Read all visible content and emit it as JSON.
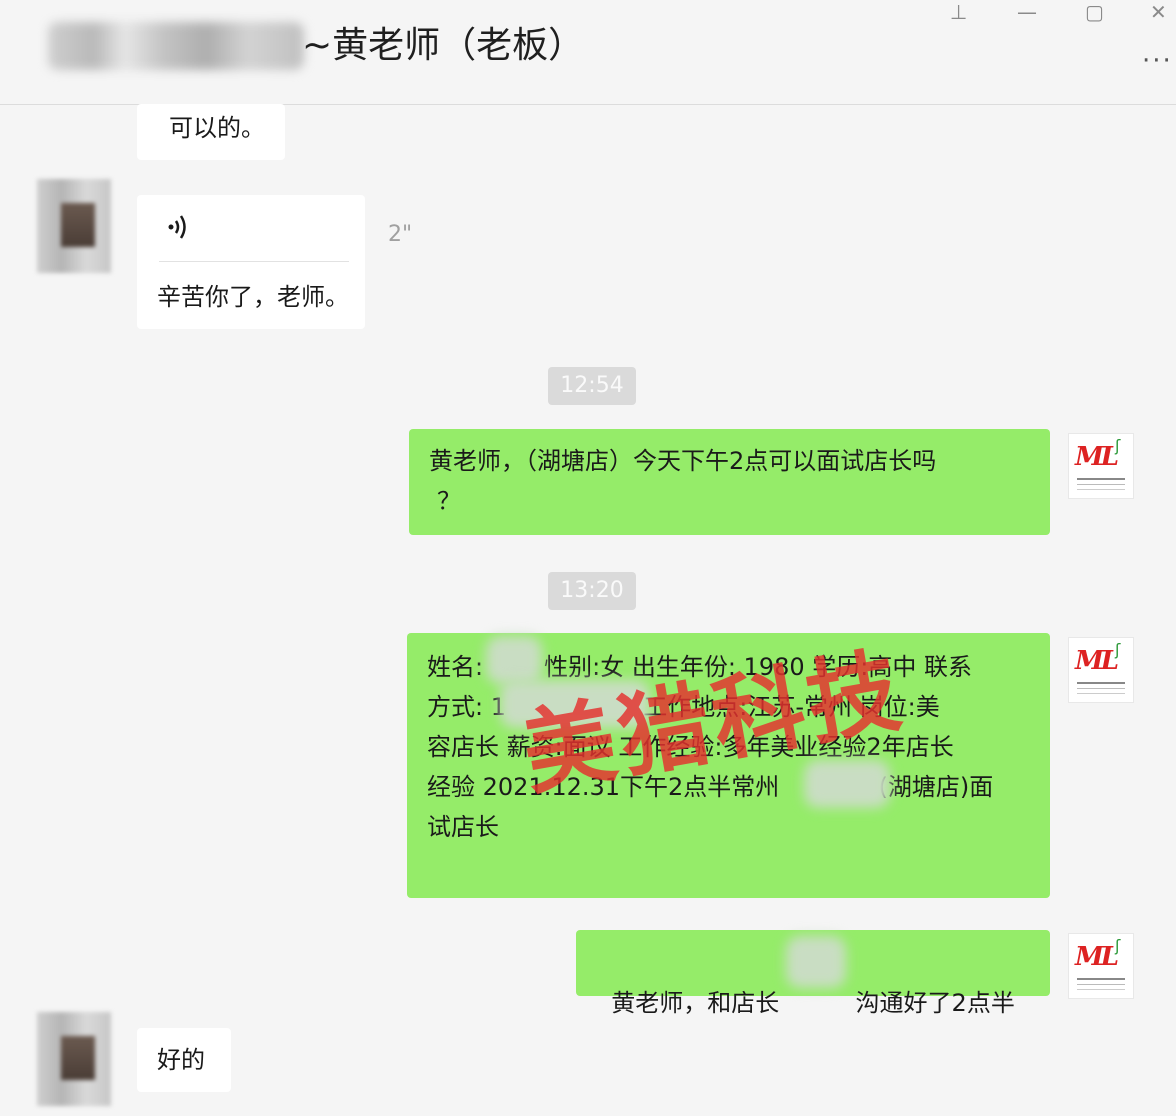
{
  "header": {
    "title": "~黄老师（老板）",
    "controls": {
      "pin": "⊥",
      "minimize": "—",
      "maximize": "▢",
      "close": "✕"
    },
    "more": "···"
  },
  "messages": [
    {
      "side": "left",
      "text": "可以的。"
    },
    {
      "side": "left",
      "voice_duration": "2\"",
      "transcript": "辛苦你了，老师。"
    },
    {
      "type": "time",
      "text": "12:54"
    },
    {
      "side": "right",
      "text_line1": "黄老师，（湖塘店）今天下午2点可以面试店长吗",
      "text_line2": "？"
    },
    {
      "type": "time",
      "text": "13:20"
    },
    {
      "side": "right",
      "lines": [
        "姓名:        性别:女 出生年份: 1980 学历:高中 联系",
        "方式: 1                  工作地点:江苏-常州 岗位:美",
        "容店长 薪资:面议 工作经验:多年美业经验2年店长",
        "经验 2021.12.31下午2点半常州             (湖塘店)面",
        "试店长"
      ]
    },
    {
      "side": "right",
      "text": "黄老师，和店长          沟通好了2点半"
    },
    {
      "side": "left",
      "text": "好的"
    }
  ],
  "watermark": "美猎科技",
  "colors": {
    "mine_bubble": "#95ec69",
    "other_bubble": "#ffffff",
    "background": "#f5f5f5",
    "watermark": "#e5312e"
  }
}
